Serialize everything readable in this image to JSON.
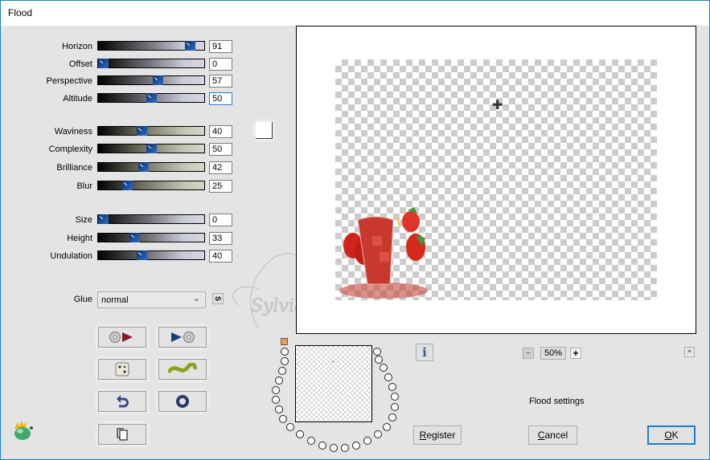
{
  "window": {
    "title": "Flood"
  },
  "sliders": {
    "group1": [
      {
        "label": "Horizon",
        "value": "91",
        "pos": 0.91,
        "style": "gray"
      },
      {
        "label": "Offset",
        "value": "0",
        "pos": 0.0,
        "style": "gray"
      },
      {
        "label": "Perspective",
        "value": "57",
        "pos": 0.57,
        "style": "gray"
      },
      {
        "label": "Altitude",
        "value": "50",
        "pos": 0.5,
        "style": "gray",
        "focused": true
      }
    ],
    "group2": [
      {
        "label": "Waviness",
        "value": "40",
        "pos": 0.4,
        "style": "olive"
      },
      {
        "label": "Complexity",
        "value": "50",
        "pos": 0.5,
        "style": "olive"
      },
      {
        "label": "Brilliance",
        "value": "42",
        "pos": 0.42,
        "style": "olive"
      },
      {
        "label": "Blur",
        "value": "25",
        "pos": 0.25,
        "style": "olive"
      }
    ],
    "group3": [
      {
        "label": "Size",
        "value": "0",
        "pos": 0.0,
        "style": "gray"
      },
      {
        "label": "Height",
        "value": "33",
        "pos": 0.33,
        "style": "gray"
      },
      {
        "label": "Undulation",
        "value": "40",
        "pos": 0.4,
        "style": "gray"
      }
    ]
  },
  "color_swatch": {
    "color": "#ffffff"
  },
  "glue": {
    "label": "Glue",
    "value": "normal",
    "s_button": "S"
  },
  "icon_buttons": [
    {
      "name": "load-preset-button",
      "icon": "disc-arrow-right-icon"
    },
    {
      "name": "save-preset-button",
      "icon": "arrow-disc-icon"
    },
    {
      "name": "randomize-button",
      "icon": "dice-icon"
    },
    {
      "name": "wave-button",
      "icon": "wave-icon"
    },
    {
      "name": "undo-button",
      "icon": "undo-arrow-icon"
    },
    {
      "name": "reset-button",
      "icon": "ring-icon"
    },
    {
      "name": "copy-button",
      "icon": "copy-pages-icon"
    }
  ],
  "preview": {
    "zoom": "50%",
    "zoom_minus": "−",
    "zoom_plus": "+",
    "collapse": "^",
    "info": "i"
  },
  "status": {
    "text": "Flood settings"
  },
  "footer": {
    "register": {
      "u": "R",
      "rest": "egister"
    },
    "cancel": {
      "u": "C",
      "rest": "ancel"
    },
    "ok": {
      "u": "O",
      "rest": "K"
    }
  },
  "watermark": {
    "text": "Sylviane"
  }
}
